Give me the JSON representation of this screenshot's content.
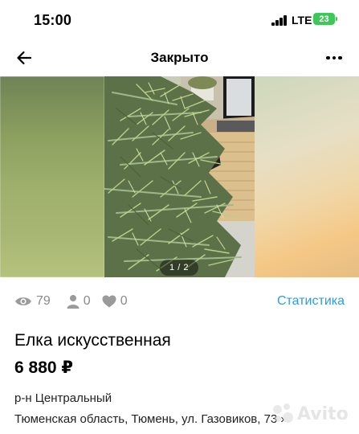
{
  "status_bar": {
    "time": "15:00",
    "network": "LTE",
    "battery": "23"
  },
  "nav": {
    "title": "Закрыто",
    "back_icon": "arrow-left-icon",
    "more_icon": "more-dots-icon"
  },
  "gallery": {
    "counter": "1 / 2",
    "current_index": 1,
    "total": 2
  },
  "stats": {
    "views": "79",
    "contacts": "0",
    "favorites": "0",
    "link_label": "Статистика"
  },
  "listing": {
    "title": "Елка искусственная",
    "price": "6 880 ₽",
    "district": "р-н Центральный",
    "address": "Тюменская область, Тюмень, ул. Газовиков, 73 ›"
  },
  "watermark": "Avito",
  "colors": {
    "accent_link": "#2f9be0",
    "battery": "#3fc85a",
    "muted_text": "#8a8a8a"
  }
}
